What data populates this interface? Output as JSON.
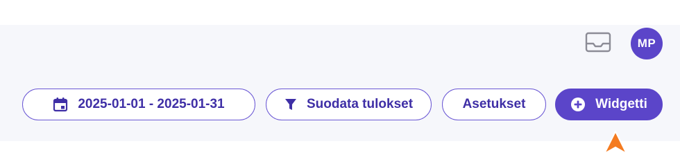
{
  "header": {
    "inbox_icon": "inbox-tray-icon",
    "avatar_initials": "MP"
  },
  "toolbar": {
    "date_range_label": "2025-01-01 - 2025-01-31",
    "date_icon": "calendar-icon",
    "filter_label": "Suodata tulokset",
    "filter_icon": "funnel-icon",
    "settings_label": "Asetukset",
    "widget_label": "Widgetti",
    "widget_icon": "plus-circle-icon"
  },
  "colors": {
    "accent": "#5b45c9",
    "outline": "#6a57d4",
    "text_accent": "#3f2fa6",
    "panel_background": "#f6f7fb",
    "pointer": "#f47b20"
  }
}
